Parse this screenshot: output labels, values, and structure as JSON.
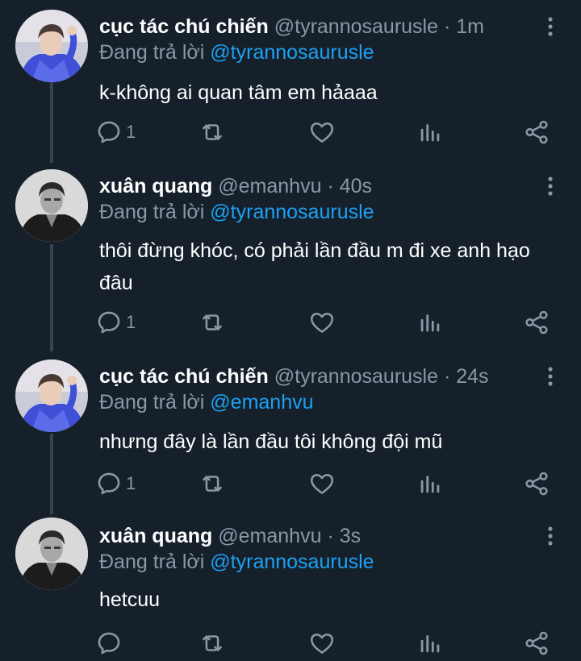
{
  "colors": {
    "background": "#15202b",
    "thread_line": "#38444d",
    "secondary_text": "#8899a6",
    "link": "#1da1f2"
  },
  "labels": {
    "replying_prefix": "Đang trả lời",
    "separator": "·"
  },
  "tweets": [
    {
      "avatar_icon": "blue-sweater-avatar",
      "display_name": "cục tác chú chiến",
      "handle": "@tyrannosaurusle",
      "time": "1m",
      "reply_to": "@tyrannosaurusle",
      "text": "k-không ai quan tâm em hảaaa",
      "reply_count": "1"
    },
    {
      "avatar_icon": "monochrome-avatar",
      "display_name": "xuân quang",
      "handle": "@emanhvu",
      "time": "40s",
      "reply_to": "@tyrannosaurusle",
      "text": "thôi đừng khóc, có phải lần đầu m đi xe anh hạo đâu",
      "reply_count": "1"
    },
    {
      "avatar_icon": "blue-sweater-avatar",
      "display_name": "cục tác chú chiến",
      "handle": "@tyrannosaurusle",
      "time": "24s",
      "reply_to": "@emanhvu",
      "text": "nhưng đây là lần đầu tôi không đội mũ",
      "reply_count": "1"
    },
    {
      "avatar_icon": "monochrome-avatar",
      "display_name": "xuân quang",
      "handle": "@emanhvu",
      "time": "3s",
      "reply_to": "@tyrannosaurusle",
      "text": "hetcuu",
      "reply_count": ""
    }
  ]
}
